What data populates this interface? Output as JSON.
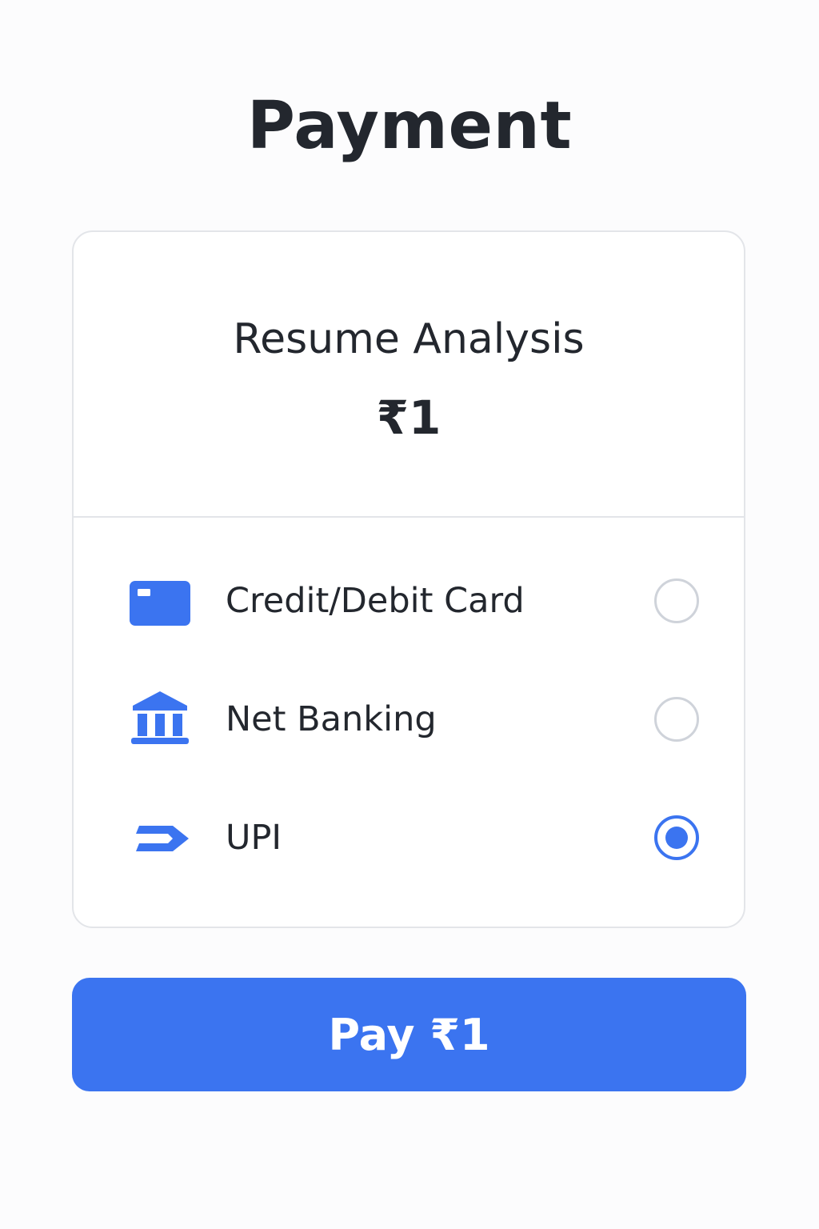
{
  "title": "Payment",
  "product": {
    "name": "Resume Analysis",
    "price": "₹1"
  },
  "payment_methods": [
    {
      "label": "Credit/Debit Card",
      "icon": "credit-card-icon",
      "selected": false
    },
    {
      "label": "Net Banking",
      "icon": "bank-icon",
      "selected": false
    },
    {
      "label": "UPI",
      "icon": "upi-icon",
      "selected": true
    }
  ],
  "pay_button": {
    "label": "Pay ₹1"
  },
  "colors": {
    "accent": "#3b74f0",
    "text": "#23272e",
    "border": "#e3e5e9",
    "radio_unselected": "#cfd3da"
  }
}
